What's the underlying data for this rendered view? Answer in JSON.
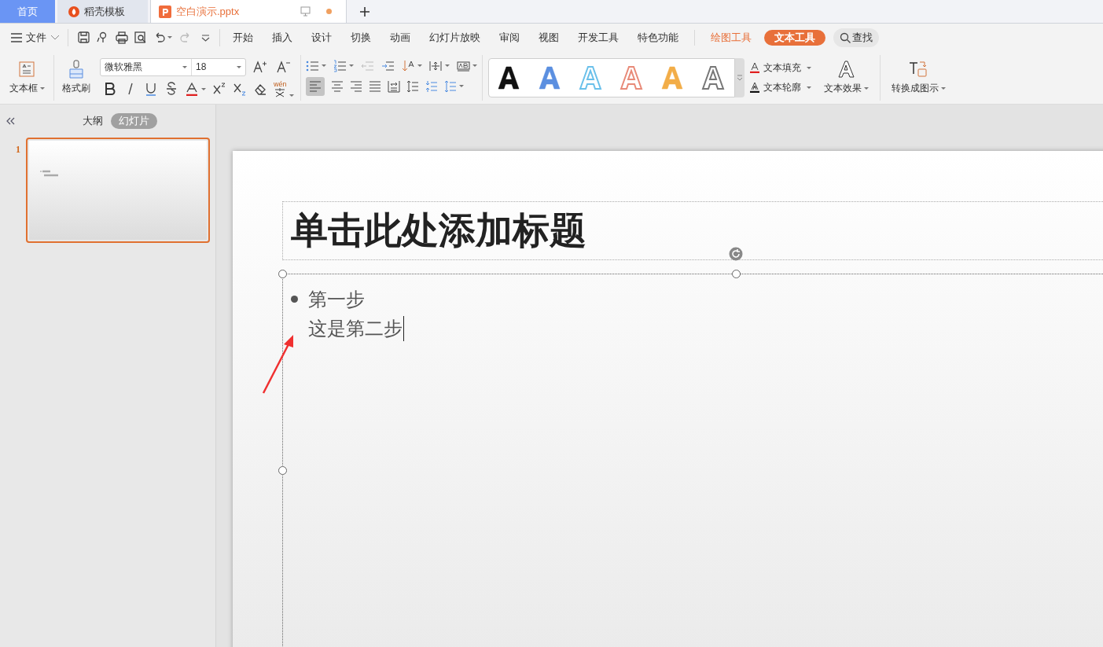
{
  "doc_tabs": [
    {
      "label": "首页",
      "kind": "home",
      "selected": false
    },
    {
      "label": "稻壳模板",
      "kind": "template",
      "selected": false
    },
    {
      "label": "空白演示.pptx",
      "kind": "document",
      "selected": true,
      "unsaved": true
    }
  ],
  "menu": {
    "file": "文件",
    "tabs": [
      {
        "label": "开始",
        "selected": false
      },
      {
        "label": "插入",
        "selected": false
      },
      {
        "label": "设计",
        "selected": false
      },
      {
        "label": "切换",
        "selected": false
      },
      {
        "label": "动画",
        "selected": false
      },
      {
        "label": "幻灯片放映",
        "selected": false
      },
      {
        "label": "审阅",
        "selected": false
      },
      {
        "label": "视图",
        "selected": false
      },
      {
        "label": "开发工具",
        "selected": false
      },
      {
        "label": "特色功能",
        "selected": false
      }
    ],
    "context_tabs": [
      {
        "label": "绘图工具",
        "selected": false
      },
      {
        "label": "文本工具",
        "selected": true
      }
    ],
    "search": "查找"
  },
  "ribbon": {
    "text_box": "文本框",
    "format_painter": "格式刷",
    "font": "微软雅黑",
    "font_size": "18",
    "phonetic": "wén",
    "wordart": [
      {
        "color": "#111111"
      },
      {
        "color": "#5b8fe0"
      },
      {
        "color": "#6ac0ea"
      },
      {
        "color": "#e88a78"
      },
      {
        "color": "#f2ad48"
      },
      {
        "color": "#777777"
      }
    ],
    "text_fill": "文本填充",
    "text_outline": "文本轮廓",
    "text_effect": "文本效果",
    "convert": "转换成图示"
  },
  "panel": {
    "tabs": [
      {
        "label": "大纲",
        "selected": false
      },
      {
        "label": "幻灯片",
        "selected": true
      }
    ],
    "slides": [
      {
        "number": "1",
        "selected": true
      }
    ]
  },
  "slide": {
    "title": "单击此处添加标题",
    "lines": [
      {
        "text": "第一步",
        "bullet": true
      },
      {
        "text": "这是第二步",
        "bullet": false
      }
    ]
  }
}
